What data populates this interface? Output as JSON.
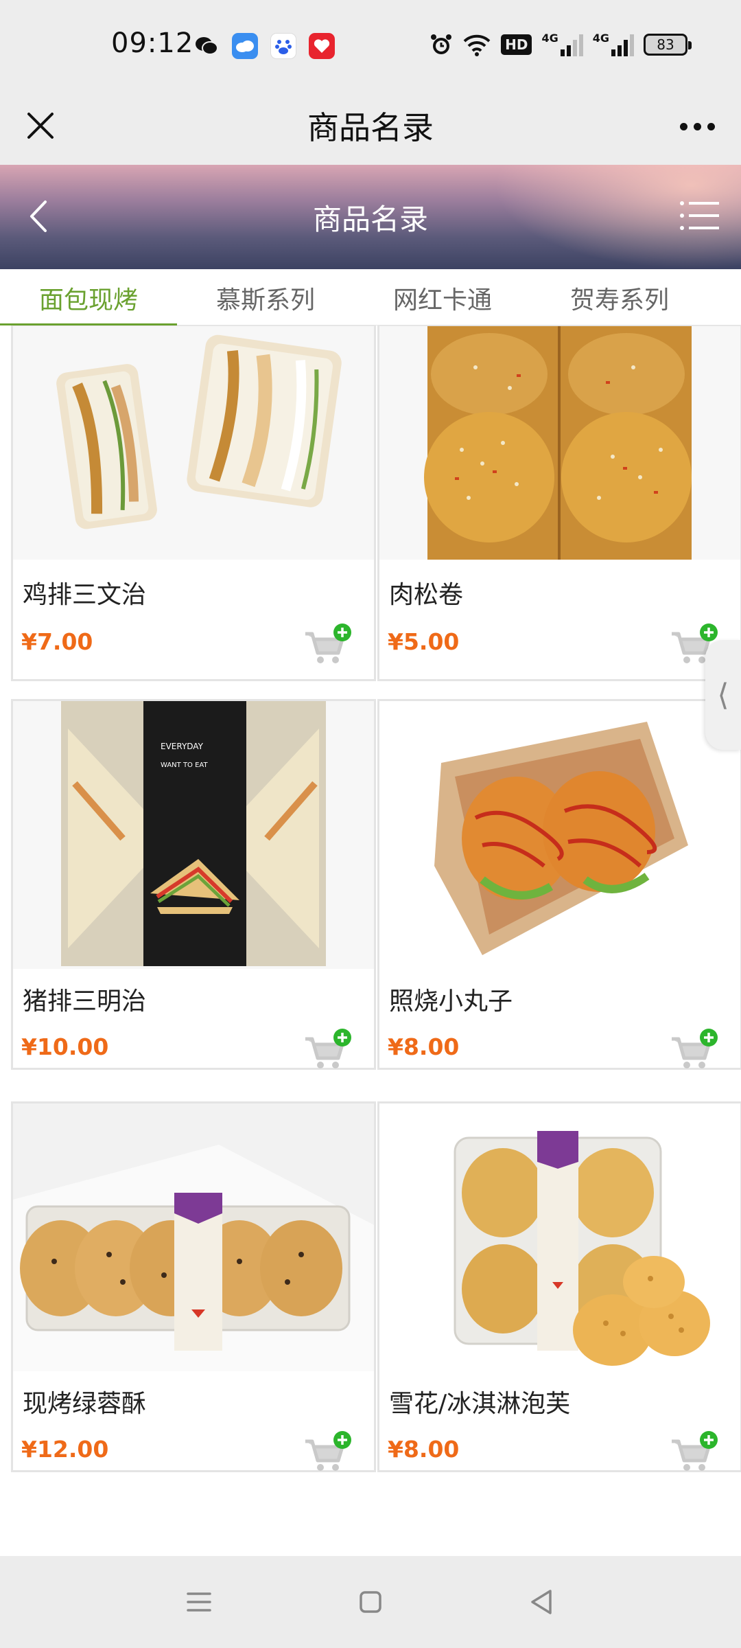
{
  "status_bar": {
    "time": "09:12",
    "apps": [
      "wechat-icon",
      "weather-icon",
      "baidu-icon",
      "app-icon"
    ],
    "hd_badge": "HD",
    "signal_label_1": "4G",
    "signal_label_2": "4G",
    "battery": "83"
  },
  "wx_bar": {
    "title": "商品名录"
  },
  "page_header": {
    "title": "商品名录"
  },
  "tabs": [
    {
      "label": "面包现烤",
      "active": true
    },
    {
      "label": "慕斯系列",
      "active": false
    },
    {
      "label": "网红卡通",
      "active": false
    },
    {
      "label": "贺寿系列",
      "active": false
    }
  ],
  "products": [
    {
      "name": "鸡排三文治",
      "price": "¥7.00"
    },
    {
      "name": "肉松卷",
      "price": "¥5.00"
    },
    {
      "name": "猪排三明治",
      "price": "¥10.00"
    },
    {
      "name": "照烧小丸子",
      "price": "¥8.00"
    },
    {
      "name": "现烤绿蓉酥",
      "price": "¥12.00"
    },
    {
      "name": "雪花/冰淇淋泡芙",
      "price": "¥8.00"
    }
  ],
  "side_handle": "⟨",
  "colors": {
    "accent_green": "#6aa12f",
    "price_orange": "#ef6a18",
    "cart_plus_green": "#2cb52c"
  }
}
